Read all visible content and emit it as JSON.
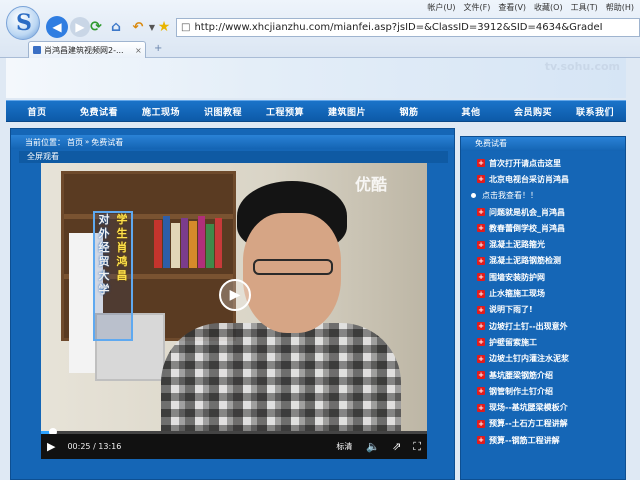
{
  "browser": {
    "logo_glyph": "S",
    "url": "http://www.xhcjianzhu.com/mianfei.asp?jsID=&ClassID=3912&SID=4634&GradeI",
    "menu": [
      "帐户(U)",
      "文件(F)",
      "查看(V)",
      "收藏(O)",
      "工具(T)",
      "帮助(H)"
    ],
    "tab_title": "肖鸿昌建筑视频网2-...",
    "tab_close": "×",
    "new_tab": "+"
  },
  "banner": {
    "watermark": "tv.sohu.com"
  },
  "main_nav": [
    "首页",
    "免费试看",
    "施工现场",
    "识图教程",
    "工程预算",
    "建筑图片",
    "钢筋",
    "其他",
    "会员购买",
    "联系我们"
  ],
  "breadcrumb": {
    "prefix": "当前位置：",
    "home": "首页",
    "sep": "»",
    "current": "免费试看"
  },
  "fullscreen_label": "全屏观看",
  "video": {
    "caption_left": [
      "对",
      "外",
      "经",
      "贸",
      "大",
      "学"
    ],
    "caption_right": [
      "学",
      "生",
      "肖",
      "鸿",
      "昌"
    ],
    "watermark": "优酷",
    "time": "00:25 / 13:16",
    "quality": "标清",
    "progress": 0.03
  },
  "sidebar": {
    "title": "免费试看",
    "items": [
      {
        "label": "首次打开请点击这里",
        "type": "plus"
      },
      {
        "label": "北京电视台采访肖鸿昌",
        "type": "plus"
      },
      {
        "label": "点击我查看！！",
        "type": "dot"
      },
      {
        "label": "问题就是机会_肖鸿昌",
        "type": "plus"
      },
      {
        "label": "教春蕾倒学校_肖鸿昌",
        "type": "plus"
      },
      {
        "label": "混凝土泥路箍光",
        "type": "plus"
      },
      {
        "label": "混凝土泥路钢筋检测",
        "type": "plus"
      },
      {
        "label": "围墙安装防护网",
        "type": "plus"
      },
      {
        "label": "止水箍施工现场",
        "type": "plus"
      },
      {
        "label": "说明下雨了!",
        "type": "plus"
      },
      {
        "label": "边坡打土钉--出现意外",
        "type": "plus"
      },
      {
        "label": "护壁留索施工",
        "type": "plus"
      },
      {
        "label": "边坡土钉内灌注水泥浆",
        "type": "plus"
      },
      {
        "label": "基坑腰梁钢筋介绍",
        "type": "plus"
      },
      {
        "label": "钢管制作土钉介绍",
        "type": "plus"
      },
      {
        "label": "现场--基坑腰梁模板介",
        "type": "plus"
      },
      {
        "label": "预算--土石方工程讲解",
        "type": "plus"
      },
      {
        "label": "预算--钢筋工程讲解",
        "type": "plus"
      }
    ]
  }
}
